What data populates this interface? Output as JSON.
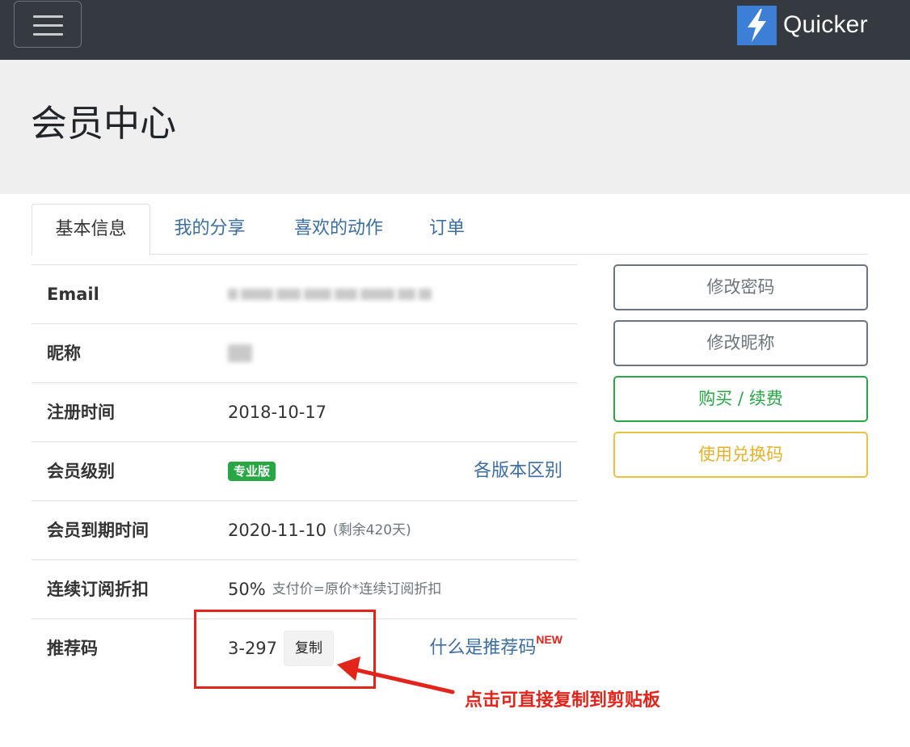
{
  "navbar": {
    "toggle_icon": "hamburger-menu-icon",
    "brand_logo_icon": "lightning-bolt-icon",
    "brand_name": "Quicker",
    "bg_color": "#343a40"
  },
  "page": {
    "title": "会员中心"
  },
  "tabs": [
    {
      "label": "基本信息",
      "active": true
    },
    {
      "label": "我的分享",
      "active": false
    },
    {
      "label": "喜欢的动作",
      "active": false
    },
    {
      "label": "订单",
      "active": false
    }
  ],
  "info": {
    "email": {
      "label": "Email"
    },
    "nickname": {
      "label": "昵称"
    },
    "register": {
      "label": "注册时间",
      "value": "2018-10-17"
    },
    "level": {
      "label": "会员级别",
      "badge": "专业版",
      "link": "各版本区别"
    },
    "expire": {
      "label": "会员到期时间",
      "value": "2020-11-10",
      "note": "(剩余420天)"
    },
    "discount": {
      "label": "连续订阅折扣",
      "value": "50%",
      "note": "支付价=原价*连续订阅折扣"
    },
    "referral": {
      "label": "推荐码",
      "value": "3-297",
      "copy_label": "复制",
      "link": "什么是推荐码",
      "new_badge": "NEW"
    }
  },
  "actions": {
    "change_password": "修改密码",
    "change_nickname": "修改昵称",
    "buy_renew": "购买 / 续费",
    "redeem_code": "使用兑换码"
  },
  "annotation": {
    "text": "点击可直接复制到剪贴板",
    "color": "#e3241b"
  },
  "colors": {
    "link": "#3a6ea5",
    "success": "#28a745",
    "warning": "#f0c040",
    "secondary": "#6c757d"
  }
}
